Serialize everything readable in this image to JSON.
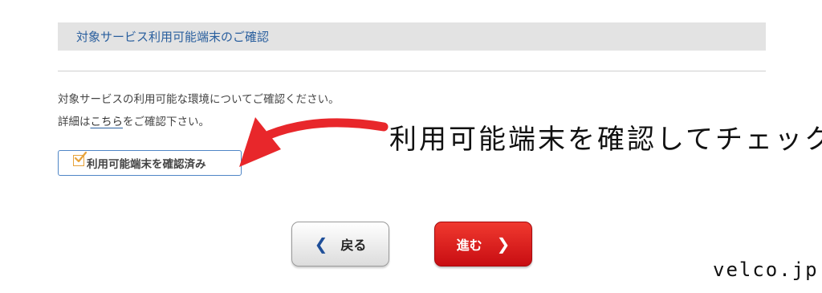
{
  "section": {
    "title": "対象サービス利用可能端末のご確認"
  },
  "description": {
    "line1": "対象サービスの利用可能な環境についてご確認ください。",
    "line2_prefix": "詳細は",
    "line2_link": "こちら",
    "line2_suffix": "をご確認下さい。"
  },
  "confirm": {
    "label": "利用可能端末を確認済み",
    "checked": true
  },
  "annotation": {
    "text": "利用可能端末を確認してチェック"
  },
  "buttons": {
    "back_label": "戻る",
    "back_icon": "chevron-left-icon",
    "next_label": "進む",
    "next_icon": "chevron-right-icon"
  },
  "watermark": {
    "text": "velco.jp"
  },
  "colors": {
    "header_bg": "#e3e3e3",
    "header_text": "#2a5f9e",
    "next_button": "#e3191d",
    "checkbox_accent": "#e8a33a",
    "arrow": "#e8272b"
  }
}
